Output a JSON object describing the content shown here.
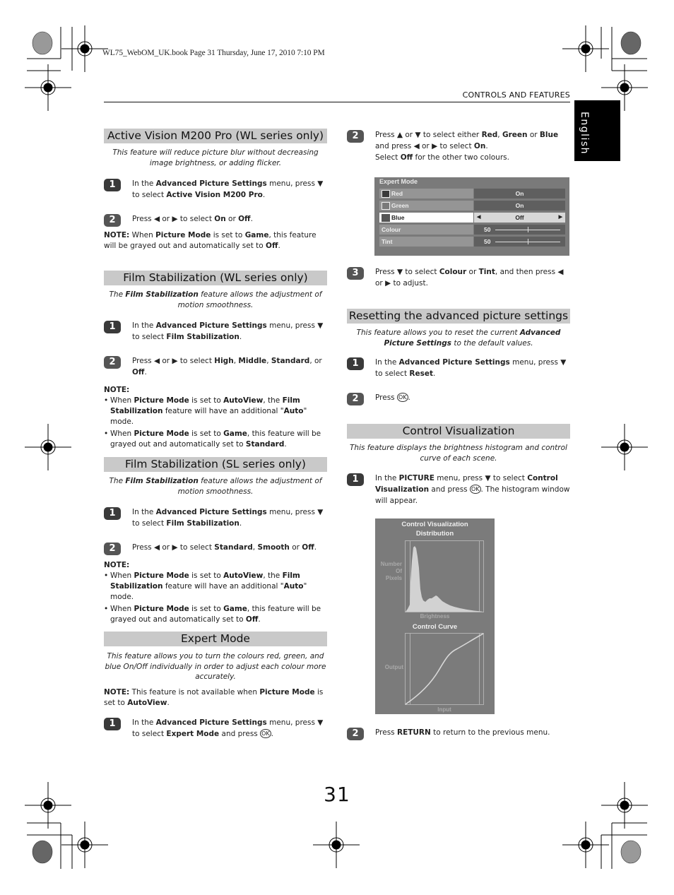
{
  "book_header": "WL75_WebOM_UK.book  Page 31  Thursday, June 17, 2010  7:10 PM",
  "section_label": "CONTROLS AND FEATURES",
  "language_tab": "English",
  "page_number": "31",
  "left_column": {
    "active_vision": {
      "title": "Active Vision M200 Pro (WL series only)",
      "intro": "This feature will reduce picture blur without decreasing image brightness, or adding flicker.",
      "steps": [
        {
          "num": "1",
          "text_html": "In the <b>Advanced Picture Settings</b> menu, press ▼ to select <b>Active Vision M200 Pro</b>."
        },
        {
          "num": "2",
          "text_html": "Press ◀ or ▶ to select <b>On</b> or <b>Off</b>."
        }
      ],
      "note_html": "<b>NOTE:</b> When <b>Picture Mode</b> is set to <b>Game</b>, this feature will be grayed out and automatically set to <b>Off</b>."
    },
    "film_stab_wl": {
      "title": "Film Stabilization (WL series only)",
      "intro_html": "The <b>Film Stabilization</b> feature allows the adjustment of motion smoothness.",
      "steps": [
        {
          "num": "1",
          "text_html": "In the <b>Advanced Picture Settings</b> menu, press ▼ to select <b>Film Stabilization</b>."
        },
        {
          "num": "2",
          "text_html": "Press ◀ or ▶ to select <b>High</b>, <b>Middle</b>, <b>Standard</b>, or <b>Off</b>."
        }
      ],
      "note_label": "NOTE:",
      "notes_html": [
        "When <b>Picture Mode</b> is set to <b>AutoView</b>, the <b>Film Stabilization</b> feature will have an additional \"<b>Auto</b>\" mode.",
        "When <b>Picture Mode</b> is set to <b>Game</b>, this feature will be grayed out and automatically set to <b>Standard</b>."
      ]
    },
    "film_stab_sl": {
      "title": "Film Stabilization (SL series only)",
      "intro_html": "The <b>Film Stabilization</b> feature allows the adjustment of motion smoothness.",
      "steps": [
        {
          "num": "1",
          "text_html": "In the <b>Advanced Picture Settings</b> menu, press ▼ to select <b>Film Stabilization</b>."
        },
        {
          "num": "2",
          "text_html": "Press ◀ or ▶ to select <b>Standard</b>, <b>Smooth</b> or <b>Off</b>."
        }
      ],
      "note_label": "NOTE:",
      "notes_html": [
        "When <b>Picture Mode</b> is set to <b>AutoView</b>, the <b>Film Stabilization</b> feature will have an additional \"<b>Auto</b>\" mode.",
        "When <b>Picture Mode</b> is set to <b>Game</b>, this feature will be grayed out and automatically set to <b>Off</b>."
      ]
    },
    "expert_mode": {
      "title": "Expert Mode",
      "intro": "This feature allows you to turn the colours red, green, and blue On/Off individually in order to adjust each colour more accurately.",
      "note_html": "<b>NOTE:</b> This feature is not available when <b>Picture Mode</b> is set to <b>AutoView</b>.",
      "steps": [
        {
          "num": "1",
          "text_html": "In the <b>Advanced Picture Settings</b> menu, press ▼ to select <b>Expert Mode</b> and press <span class=\"ok\">OK</span>."
        }
      ]
    }
  },
  "right_column": {
    "expert_steps": [
      {
        "num": "2",
        "text_html": "Press ▲ or ▼ to select either <b>Red</b>, <b>Green</b> or <b>Blue</b> and press ◀ or ▶ to select <b>On</b>.<br>Select <b>Off</b> for the other two colours."
      },
      {
        "num": "3",
        "text_html": "Press ▼ to select <b>Colour</b> or <b>Tint</b>, and then press ◀ or ▶ to adjust."
      }
    ],
    "osd": {
      "title": "Expert Mode",
      "rows": [
        {
          "label": "Red",
          "value": "On"
        },
        {
          "label": "Green",
          "value": "On"
        },
        {
          "label": "Blue",
          "value": "Off",
          "selected": true
        },
        {
          "label": "Colour",
          "value": "50",
          "slider_fraction": 0.5
        },
        {
          "label": "Tint",
          "value": "50",
          "slider_fraction": 0.5
        }
      ],
      "left_arrow": "◀",
      "right_arrow": "▶"
    },
    "reset": {
      "title": "Resetting the advanced picture settings",
      "intro_html": "This feature allows you to reset the current <b>Advanced Picture Settings</b> to the default values.",
      "steps": [
        {
          "num": "1",
          "text_html": "In the <b>Advanced Picture Settings</b> menu, press ▼ to select <b>Reset</b>."
        },
        {
          "num": "2",
          "text_html": "Press <span class=\"ok\">OK</span>."
        }
      ]
    },
    "control_vis": {
      "title": "Control Visualization",
      "intro": "This feature displays the brightness histogram and control curve of each scene.",
      "steps": [
        {
          "num": "1",
          "text_html": "In the <b>PICTURE</b> menu, press ▼ to select <b>Control Visualization</b> and press <span class=\"ok\">OK</span>. The histogram window will appear."
        },
        {
          "num": "2",
          "text_html": "Press <b>RETURN</b> to return to the previous menu."
        }
      ],
      "screen": {
        "title_line1": "Control Visualization",
        "title_line2": "Distribution",
        "hist_ylabel": [
          "Number",
          "Of",
          "Pixels"
        ],
        "hist_xlabel": "Brightness",
        "curve_title": "Control Curve",
        "curve_ylabel": "Output",
        "curve_xlabel": "Input"
      }
    }
  }
}
